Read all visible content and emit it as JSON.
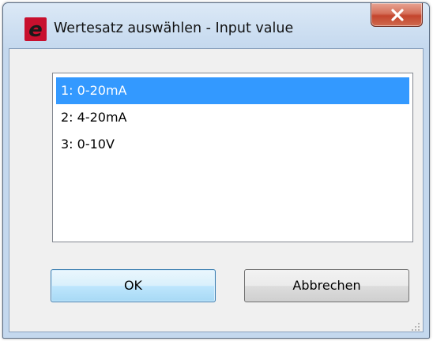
{
  "window": {
    "title": "Wertesatz auswählen - Input value",
    "app_icon": "e-logo-icon",
    "close_icon": "close-icon"
  },
  "list": {
    "items": [
      {
        "label": "1: 0-20mA",
        "selected": true
      },
      {
        "label": "2: 4-20mA",
        "selected": false
      },
      {
        "label": "3: 0-10V",
        "selected": false
      }
    ]
  },
  "buttons": {
    "ok_label": "OK",
    "cancel_label": "Abbrechen"
  },
  "colors": {
    "selection": "#3399ff",
    "close_button": "#c4452d",
    "app_icon": "#c8102e"
  }
}
